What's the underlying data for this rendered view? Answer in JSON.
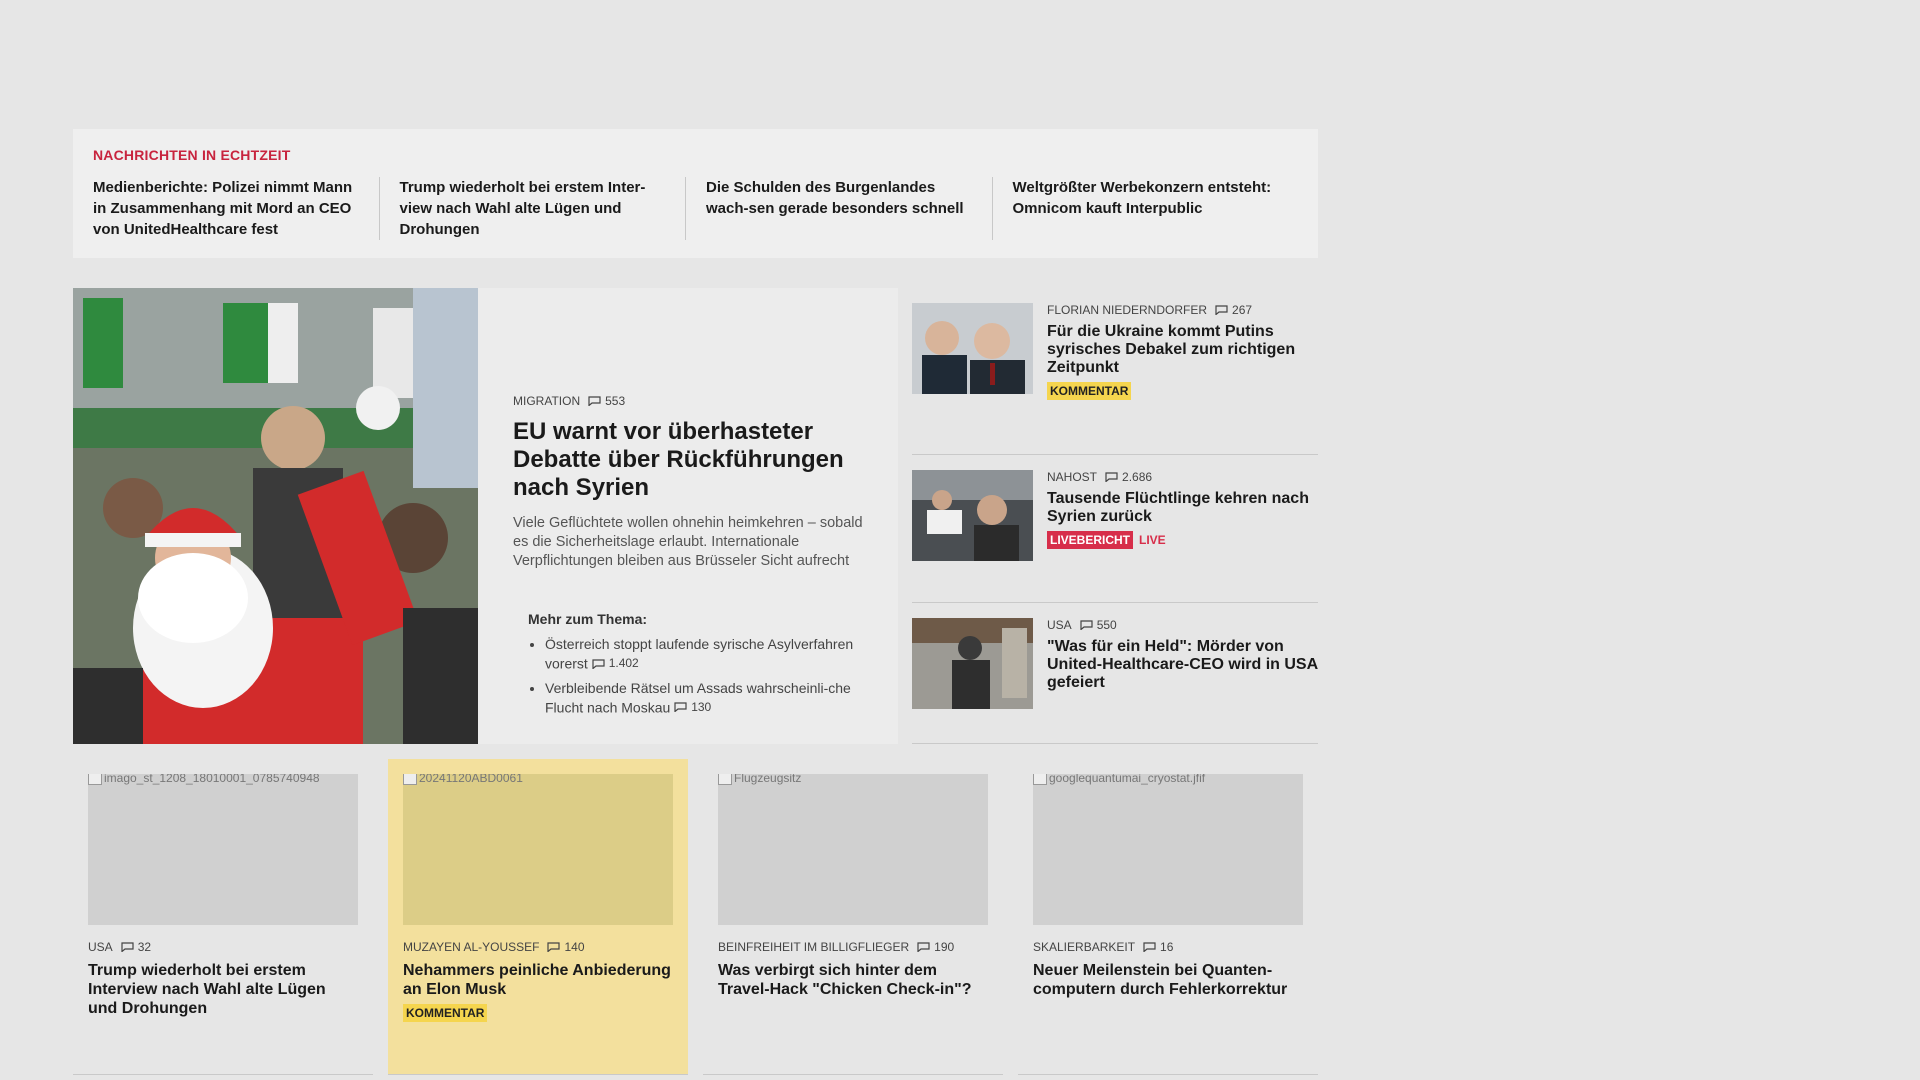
{
  "ticker": {
    "label": "NACHRICHTEN IN ECHTZEIT",
    "items": [
      "Medienberichte: Polizei nimmt Mann in Zusammenhang mit Mord an CEO von UnitedHealthcare fest",
      "Trump wiederholt bei erstem Inter-view nach Wahl alte Lügen und Drohungen",
      "Die Schulden des Burgenlandes wach-sen gerade besonders schnell",
      "Weltgrößter Werbekonzern entsteht: Omnicom kauft Interpublic"
    ]
  },
  "lead": {
    "kicker": "MIGRATION",
    "comments": "553",
    "title": "EU warnt vor überhasteter Debatte über Rückführungen nach Syrien",
    "teaser": "Viele Geflüchtete wollen ohnehin heimkehren – sobald es die Sicherheitslage erlaubt. Internationale Verpflichtungen bleiben aus Brüsseler Sicht aufrecht",
    "more_title": "Mehr zum Thema:",
    "more": [
      {
        "text": "Österreich stoppt laufende syrische Asylverfahren vorerst",
        "comments": "1.402"
      },
      {
        "text": "Verbleibende Rätsel um Assads wahrscheinli-che Flucht nach Moskau",
        "comments": "130"
      }
    ]
  },
  "side": [
    {
      "kicker": "FLORIAN NIEDERNDORFER",
      "comments": "267",
      "title": "Für die Ukraine kommt Putins syrisches Debakel zum richtigen Zeitpunkt",
      "badge": "KOMMENTAR"
    },
    {
      "kicker": "NAHOST",
      "comments": "2.686",
      "title": "Tausende Flüchtlinge kehren nach Syrien zurück",
      "badge": "LIVEBERICHT",
      "live": "LIVE"
    },
    {
      "kicker": "USA",
      "comments": "550",
      "title": "\"Was für ein Held\": Mörder von United-Healthcare-CEO wird in USA gefeiert"
    }
  ],
  "cards": [
    {
      "alt": "imago_st_1208_18010001_0785740948",
      "kicker": "USA",
      "comments": "32",
      "title": "Trump wiederholt bei erstem Interview nach Wahl alte Lügen und Drohungen"
    },
    {
      "alt": "20241120ABD0061",
      "kicker": "MUZAYEN AL-YOUSSEF",
      "comments": "140",
      "title": "Nehammers peinliche Anbiederung an Elon Musk",
      "badge": "KOMMENTAR"
    },
    {
      "alt": "Flugzeugsitz",
      "kicker": "BEINFREIHEIT IM BILLIGFLIEGER",
      "comments": "190",
      "title": "Was verbirgt sich hinter dem Travel-Hack \"Chicken Check-in\"?"
    },
    {
      "alt": "googlequantumai_cryostat.jfif",
      "kicker": "SKALIERBARKEIT",
      "comments": "16",
      "title": "Neuer Meilenstein bei Quanten-computern durch Fehlerkorrektur"
    }
  ]
}
